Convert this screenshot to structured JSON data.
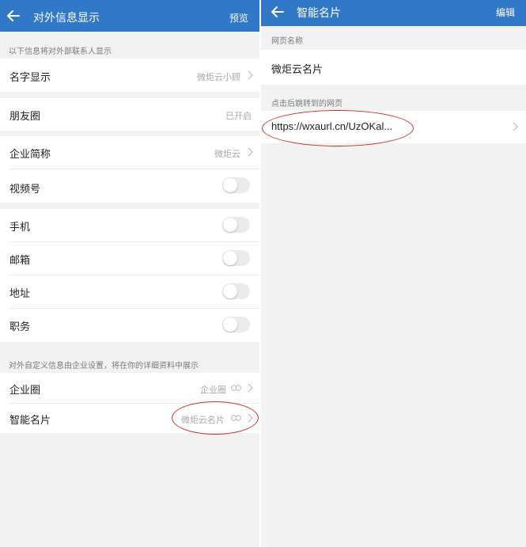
{
  "colors": {
    "header": "#3278c8",
    "annotation": "#d22a2a"
  },
  "left": {
    "header": {
      "title": "对外信息显示",
      "action": "预览",
      "back_icon": "arrow-left-icon"
    },
    "section_external": "以下信息将对外部联系人显示",
    "name_display": {
      "label": "名字显示",
      "value": "微炬云小顾"
    },
    "moments": {
      "label": "朋友圈",
      "value": "已开启"
    },
    "company_short": {
      "label": "企业简称",
      "value": "微炬云"
    },
    "channels": {
      "label": "视频号",
      "enabled": false
    },
    "phone": {
      "label": "手机",
      "enabled": false
    },
    "email": {
      "label": "邮箱",
      "enabled": false
    },
    "address": {
      "label": "地址",
      "enabled": false
    },
    "position": {
      "label": "职务",
      "enabled": false
    },
    "section_custom": "对外自定义信息由企业设置，将在你的详细资料中展示",
    "enterprise_circle": {
      "label": "企业圈",
      "value": "企业圈"
    },
    "smart_card": {
      "label": "智能名片",
      "value": "微炬云名片"
    }
  },
  "right": {
    "header": {
      "title": "智能名片",
      "action": "编辑",
      "back_icon": "arrow-left-icon"
    },
    "page_name_label": "网页名称",
    "page_name_value": "微炬云名片",
    "redirect_label": "点击后跳转到的网页",
    "redirect_url": "https://wxaurl.cn/UzOKal..."
  }
}
